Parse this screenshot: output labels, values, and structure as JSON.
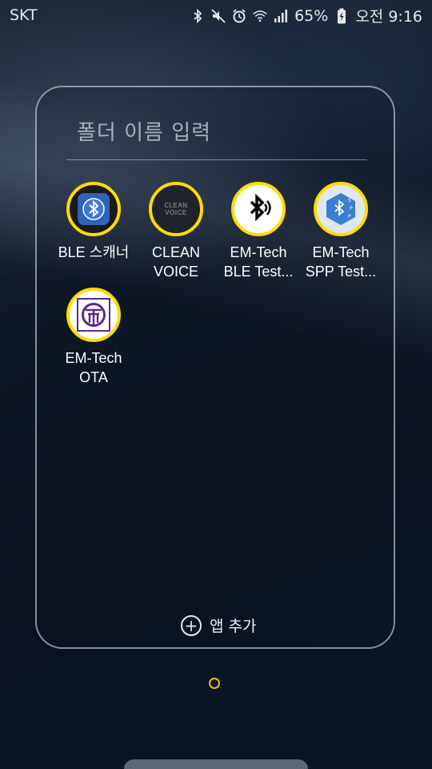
{
  "status_bar": {
    "carrier": "SKT",
    "battery_percent": "65%",
    "time": "오전 9:16",
    "icons": [
      "bluetooth-icon",
      "mute-icon",
      "alarm-icon",
      "wifi-icon",
      "signal-icon",
      "battery-icon"
    ]
  },
  "folder": {
    "name_placeholder": "폴더 이름 입력",
    "apps": [
      {
        "label_line1": "BLE 스캐너",
        "label_line2": "",
        "icon": "bluetooth-scanner-icon"
      },
      {
        "label_line1": "CLEAN",
        "label_line2": "VOICE",
        "icon": "clean-voice-icon"
      },
      {
        "label_line1": "EM-Tech",
        "label_line2": "BLE Test...",
        "icon": "bluetooth-speaker-icon"
      },
      {
        "label_line1": "EM-Tech",
        "label_line2": "SPP Test...",
        "icon": "bluetooth-spp-icon"
      },
      {
        "label_line1": "EM-Tech",
        "label_line2": "OTA",
        "icon": "em-tech-ota-icon"
      }
    ],
    "clean_voice_logo_line1": "CLEAN",
    "clean_voice_logo_line2": "VOICE",
    "add_apps_label": "앱 추가"
  },
  "colors": {
    "accent_ring": "#ffdc00",
    "ble_scanner_bg": "#2f63b8",
    "spp_icon_bg": "#3b7fd0",
    "ota_icon_border": "#5a2a8c"
  }
}
